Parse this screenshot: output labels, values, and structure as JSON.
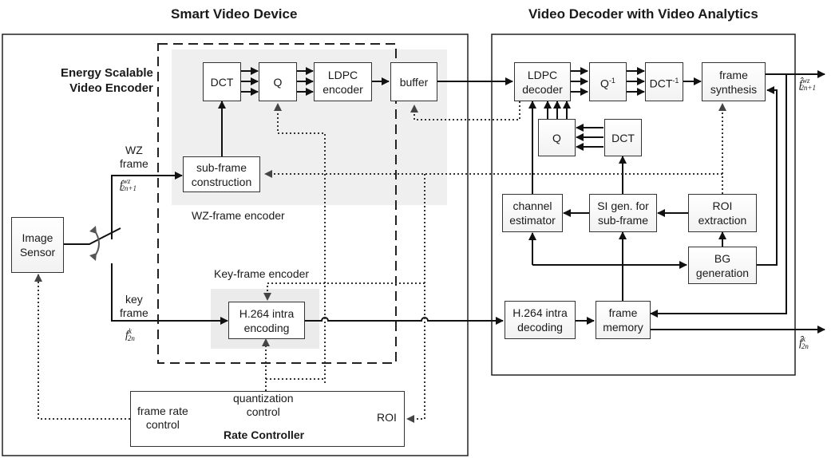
{
  "titles": {
    "smart_device": "Smart Video Device",
    "decoder": "Video Decoder with Video Analytics",
    "encoder_group": [
      "Energy Scalable",
      "Video Encoder"
    ]
  },
  "encoder": {
    "dct": "DCT",
    "q": "Q",
    "ldpc_encoder": [
      "LDPC",
      "encoder"
    ],
    "buffer": "buffer",
    "subframe": [
      "sub-frame",
      "construction"
    ],
    "wz_frame_encoder_label": "WZ-frame encoder",
    "key_frame_encoder_label": "Key-frame encoder",
    "h264_encoding": [
      "H.264 intra",
      "encoding"
    ]
  },
  "source": {
    "image_sensor": [
      "Image",
      "Sensor"
    ],
    "wz_frame_label": [
      "WZ",
      "frame"
    ],
    "wz_frame_symbol": {
      "base": "f",
      "sup": "wz",
      "sub": "2n+1"
    },
    "key_frame_label": [
      "key",
      "frame"
    ],
    "key_frame_symbol": {
      "base": "f",
      "sup": "k",
      "sub": "2n"
    }
  },
  "rate_controller": {
    "title": "Rate Controller",
    "frame_rate_control": [
      "frame rate",
      "control"
    ],
    "quantization_control": [
      "quantization",
      "control"
    ],
    "roi": "ROI"
  },
  "decoder": {
    "ldpc_decoder": [
      "LDPC",
      "decoder"
    ],
    "q_inverse": {
      "base": "Q",
      "sup": "-1"
    },
    "dct_inverse": {
      "base": "DCT",
      "sup": "-1"
    },
    "frame_synthesis": [
      "frame",
      "synthesis"
    ],
    "q": "Q",
    "dct": "DCT",
    "channel_estimator": [
      "channel",
      "estimator"
    ],
    "si_gen": [
      "SI gen. for",
      "sub-frame"
    ],
    "roi_extraction": [
      "ROI",
      "extraction"
    ],
    "bg_generation": [
      "BG",
      "generation"
    ],
    "h264_decoding": [
      "H.264 intra",
      "decoding"
    ],
    "frame_memory": [
      "frame",
      "memory"
    ],
    "output_wz_symbol": {
      "base": "f̂",
      "sup": "wz",
      "sub": "2n+1"
    },
    "output_key_symbol": {
      "base": "f̂",
      "sup": "k",
      "sub": "2n"
    }
  }
}
